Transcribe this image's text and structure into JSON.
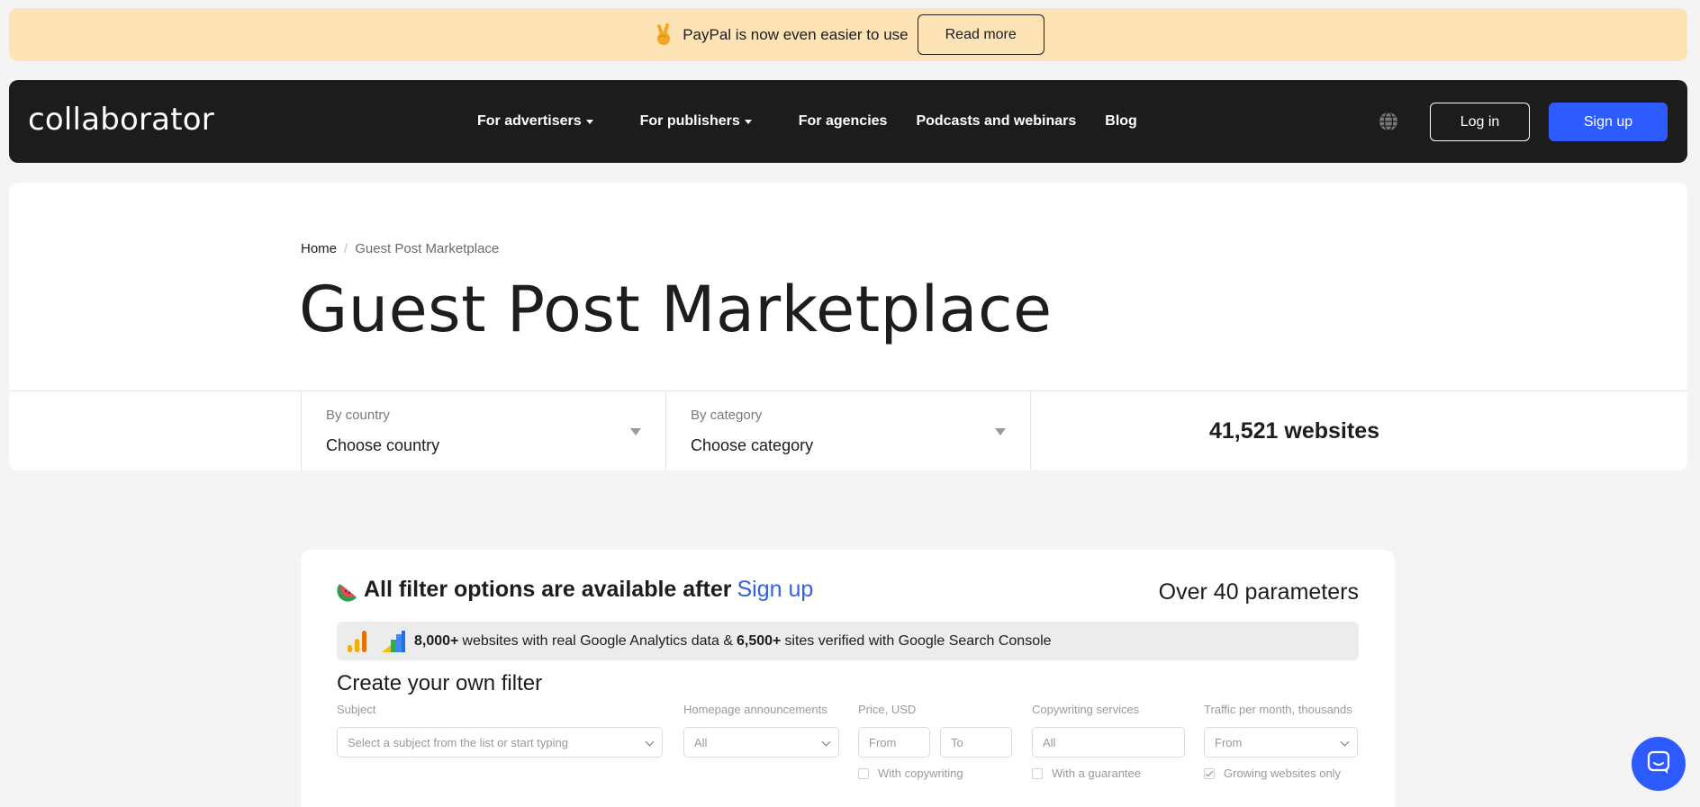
{
  "banner": {
    "icon": "victory-hand-icon",
    "text": "PayPal is now even easier to use",
    "button_label": "Read more"
  },
  "nav": {
    "logo": "collaborator",
    "menu": [
      {
        "label": "For advertisers",
        "dropdown": true
      },
      {
        "label": "For publishers",
        "dropdown": true
      },
      {
        "label": "For agencies",
        "dropdown": false
      },
      {
        "label": "Podcasts and webinars",
        "dropdown": false
      },
      {
        "label": "Blog",
        "dropdown": false
      }
    ],
    "language_icon": "globe-icon",
    "login_label": "Log in",
    "signup_label": "Sign up",
    "accent_color": "#2d5bff"
  },
  "breadcrumb": {
    "home": "Home",
    "separator": "/",
    "current": "Guest Post Marketplace"
  },
  "page_title": "Guest Post Marketplace",
  "filters": {
    "country": {
      "label": "By country",
      "value": "Choose country"
    },
    "category": {
      "label": "By category",
      "value": "Choose category"
    },
    "count": "41,521 websites"
  },
  "filter_card": {
    "headline": "All filter options are available after",
    "headline_link": "Sign up",
    "parameters": "Over 40 parameters",
    "ga_stat_1": "8,000+",
    "ga_text_1": "websites with real Google Analytics data &",
    "ga_stat_2": "6,500+",
    "ga_text_2": "sites verified with Google Search Console",
    "create_title": "Create your own filter",
    "fields": {
      "subject": {
        "label": "Subject",
        "placeholder": "Select a subject from the list or start typing"
      },
      "homepage": {
        "label": "Homepage announcements",
        "value": "All"
      },
      "price": {
        "label": "Price, USD",
        "from": "From",
        "to": "To",
        "checkbox": "With copywriting"
      },
      "copywriting": {
        "label": "Copywriting services",
        "value": "All",
        "checkbox": "With a guarantee"
      },
      "traffic": {
        "label": "Traffic per month, thousands",
        "value": "From",
        "checkbox": "Growing websites only",
        "checked": true
      }
    }
  },
  "chat_icon": "chat-bubble-icon"
}
